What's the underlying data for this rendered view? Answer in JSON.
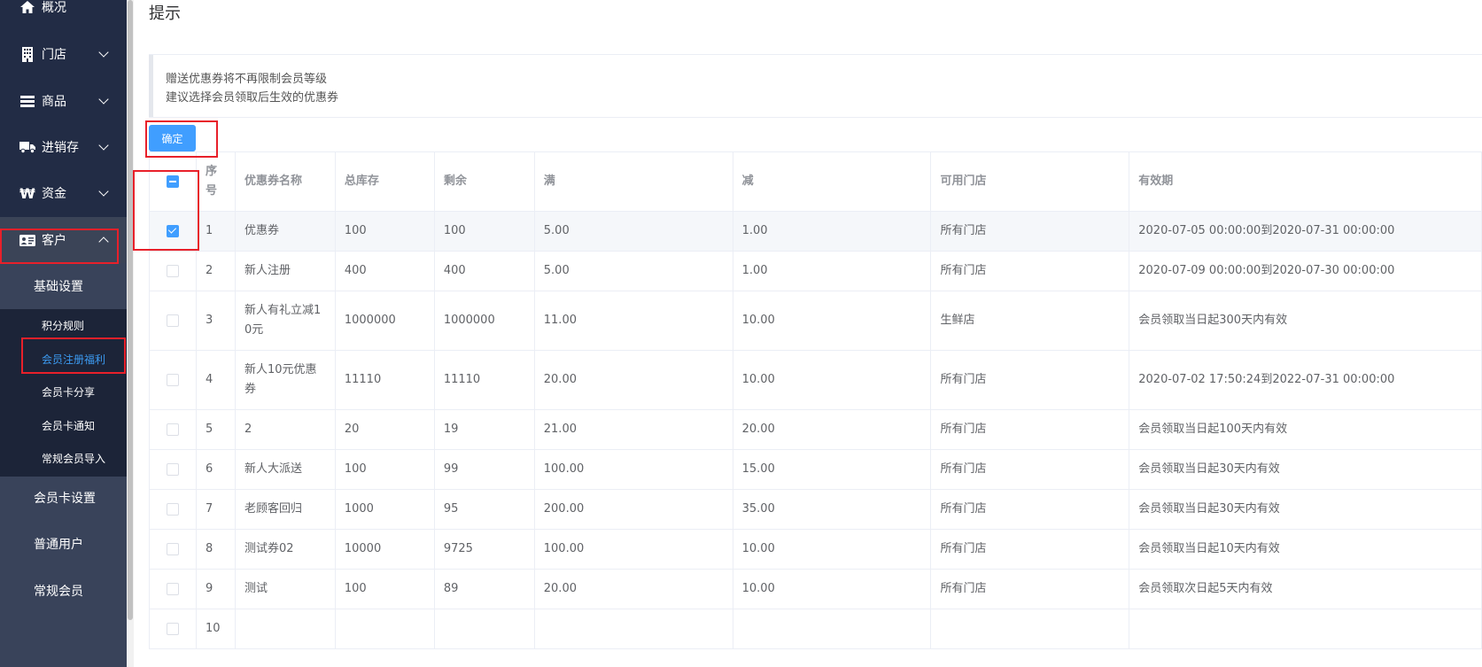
{
  "sidebar": {
    "items": [
      {
        "label": "概况",
        "icon": "home-icon"
      },
      {
        "label": "门店",
        "icon": "building-icon"
      },
      {
        "label": "商品",
        "icon": "list-icon"
      },
      {
        "label": "进销存",
        "icon": "truck-icon"
      },
      {
        "label": "资金",
        "icon": "won-icon"
      },
      {
        "label": "客户",
        "icon": "id-card-icon"
      }
    ],
    "customer_group": {
      "label": "基础设置",
      "items": [
        "积分规则",
        "会员注册福利",
        "会员卡分享",
        "会员卡通知",
        "常规会员导入"
      ],
      "active": "会员注册福利"
    },
    "more": [
      "会员卡设置",
      "普通用户",
      "常规会员"
    ]
  },
  "page": {
    "title": "提示",
    "tip_lines": [
      "赠送优惠券将不再限制会员等级",
      "建议选择会员领取后生效的优惠券"
    ],
    "confirm_label": "确定"
  },
  "table": {
    "headers": [
      "序号",
      "优惠券名称",
      "总库存",
      "剩余",
      "满",
      "减",
      "可用门店",
      "有效期"
    ],
    "rows": [
      {
        "checked": true,
        "cells": [
          "1",
          "优惠券",
          "100",
          "100",
          "5.00",
          "1.00",
          "所有门店",
          "2020-07-05 00:00:00到2020-07-31 00:00:00"
        ]
      },
      {
        "checked": false,
        "cells": [
          "2",
          "新人注册",
          "400",
          "400",
          "5.00",
          "1.00",
          "所有门店",
          "2020-07-09 00:00:00到2020-07-30 00:00:00"
        ]
      },
      {
        "checked": false,
        "cells": [
          "3",
          "新人有礼立减10元",
          "1000000",
          "1000000",
          "11.00",
          "10.00",
          "生鲜店",
          "会员领取当日起300天内有效"
        ]
      },
      {
        "checked": false,
        "cells": [
          "4",
          "新人10元优惠券",
          "11110",
          "11110",
          "20.00",
          "10.00",
          "所有门店",
          "2020-07-02 17:50:24到2022-07-31 00:00:00"
        ]
      },
      {
        "checked": false,
        "cells": [
          "5",
          "2",
          "20",
          "19",
          "21.00",
          "20.00",
          "所有门店",
          "会员领取当日起100天内有效"
        ]
      },
      {
        "checked": false,
        "cells": [
          "6",
          "新人大派送",
          "100",
          "99",
          "100.00",
          "15.00",
          "所有门店",
          "会员领取当日起30天内有效"
        ]
      },
      {
        "checked": false,
        "cells": [
          "7",
          "老顾客回归",
          "1000",
          "95",
          "200.00",
          "35.00",
          "所有门店",
          "会员领取当日起30天内有效"
        ]
      },
      {
        "checked": false,
        "cells": [
          "8",
          "测试券02",
          "10000",
          "9725",
          "100.00",
          "10.00",
          "所有门店",
          "会员领取当日起10天内有效"
        ]
      },
      {
        "checked": false,
        "cells": [
          "9",
          "测试",
          "100",
          "89",
          "20.00",
          "10.00",
          "所有门店",
          "会员领取次日起5天内有效"
        ]
      },
      {
        "checked": false,
        "cells": [
          "10",
          "",
          "",
          "",
          "",
          "",
          "",
          ""
        ]
      }
    ]
  }
}
